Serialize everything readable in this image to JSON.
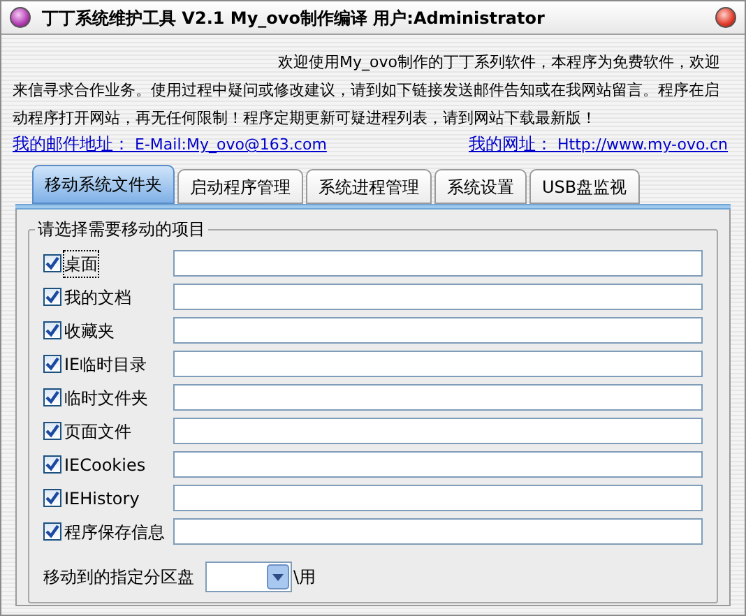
{
  "window": {
    "title": "丁丁系统维护工具 V2.1 My_ovo制作编译 用户:Administrator"
  },
  "intro": "欢迎使用My_ovo制作的丁丁系列软件，本程序为免费软件，欢迎来信寻求合作业务。使用过程中疑问或修改建议，请到如下链接发送邮件告知或在我网站留言。程序在启动程序打开网站，再无任何限制！程序定期更新可疑进程列表，请到网站下载最新版！",
  "links": [
    {
      "label": "我的邮件地址：",
      "value": "E-Mail:My_ovo@163.com"
    },
    {
      "label": "我的网址：",
      "value": "Http://www.my-ovo.cn"
    }
  ],
  "tabs": [
    {
      "label": "移动系统文件夹",
      "selected": true
    },
    {
      "label": "启动程序管理",
      "selected": false
    },
    {
      "label": "系统进程管理",
      "selected": false
    },
    {
      "label": "系统设置",
      "selected": false
    },
    {
      "label": "USB盘监视",
      "selected": false
    }
  ],
  "group": {
    "title": "请选择需要移动的项目",
    "items": [
      {
        "label": "桌面",
        "checked": true,
        "focused": true
      },
      {
        "label": "我的文档",
        "checked": true
      },
      {
        "label": "收藏夹",
        "checked": true
      },
      {
        "label": "IE临时目录",
        "checked": true
      },
      {
        "label": "临时文件夹",
        "checked": true
      },
      {
        "label": "页面文件",
        "checked": true
      },
      {
        "label": "IECookies",
        "checked": true
      },
      {
        "label": "IEHistory",
        "checked": true
      },
      {
        "label": "程序保存信息",
        "checked": true
      }
    ],
    "target_label": "移动到的指定分区盘",
    "target_suffix": "\\用"
  }
}
